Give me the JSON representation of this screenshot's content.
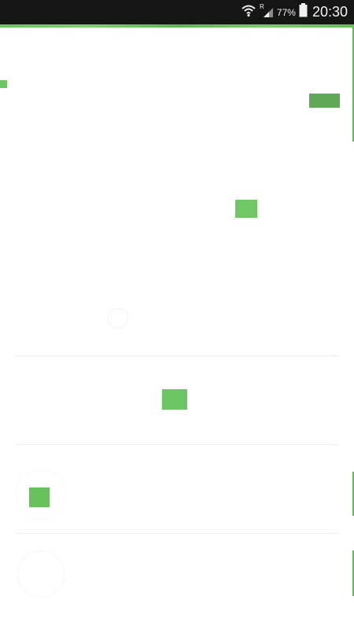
{
  "status_bar": {
    "battery": "77%",
    "time": "20:30",
    "icons": [
      "wifi-icon",
      "signal-roaming-icon",
      "battery-icon"
    ],
    "signal_label": "R"
  },
  "colors": {
    "accent": "#6cc25f",
    "button": "#5fa956",
    "status_bar_bg": "#151515"
  }
}
